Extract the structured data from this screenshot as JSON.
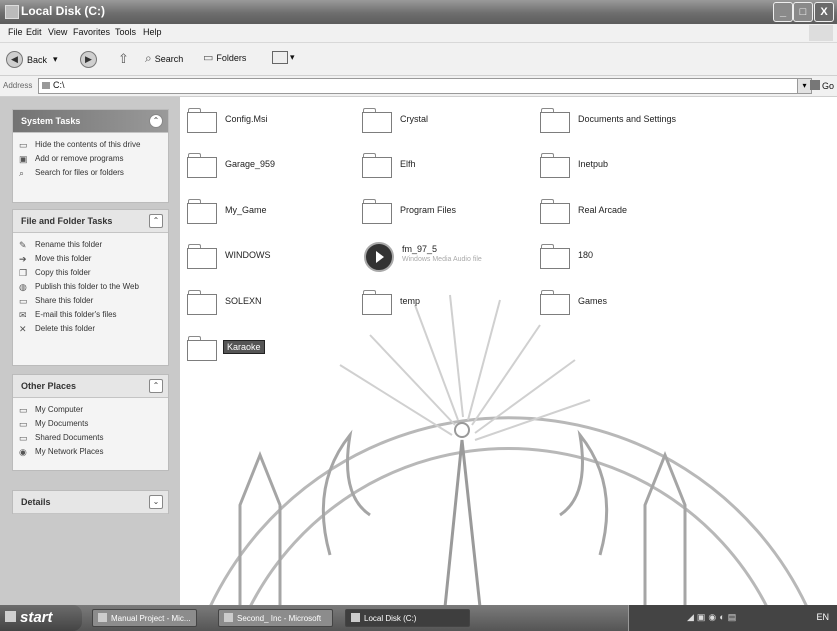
{
  "window": {
    "title": "Local Disk (C:)",
    "min": "_",
    "max": "□",
    "close": "X"
  },
  "menu": [
    "File",
    "Edit",
    "View",
    "Favorites",
    "Tools",
    "Help"
  ],
  "toolbar": {
    "back": "Back",
    "search": "Search",
    "folders": "Folders"
  },
  "address": {
    "label": "Address",
    "value": "C:\\",
    "go": "Go"
  },
  "system_tasks": {
    "title": "System Tasks",
    "items": [
      {
        "icon": "folder-icon",
        "label": "Hide the contents of this drive"
      },
      {
        "icon": "add-remove-icon",
        "label": "Add or remove programs"
      },
      {
        "icon": "search-icon",
        "label": "Search for files or folders"
      }
    ]
  },
  "file_tasks": {
    "title": "File and Folder Tasks",
    "items": [
      {
        "icon": "rename-icon",
        "label": "Rename this folder"
      },
      {
        "icon": "move-icon",
        "label": "Move this folder"
      },
      {
        "icon": "copy-icon",
        "label": "Copy this folder"
      },
      {
        "icon": "publish-icon",
        "label": "Publish this folder to the Web"
      },
      {
        "icon": "share-icon",
        "label": "Share this folder"
      },
      {
        "icon": "email-icon",
        "label": "E-mail this folder's files"
      },
      {
        "icon": "delete-icon",
        "label": "Delete this folder"
      }
    ]
  },
  "other_places": {
    "title": "Other Places",
    "items": [
      {
        "icon": "computer-icon",
        "label": "My Computer"
      },
      {
        "icon": "documents-icon",
        "label": "My Documents"
      },
      {
        "icon": "shared-icon",
        "label": "Shared Documents"
      },
      {
        "icon": "network-icon",
        "label": "My Network Places"
      }
    ]
  },
  "details": {
    "title": "Details"
  },
  "files": [
    {
      "name": "Config.Msi"
    },
    {
      "name": "Crystal"
    },
    {
      "name": "Documents and Settings"
    },
    {
      "name": "Garage_959"
    },
    {
      "name": "Elfh"
    },
    {
      "name": "Inetpub"
    },
    {
      "name": "My_Game"
    },
    {
      "name": "Program Files"
    },
    {
      "name": "Real Arcade"
    },
    {
      "name": "WINDOWS"
    },
    {
      "name": "fm_97_5",
      "sub": "Windows Media Audio file",
      "type": "media"
    },
    {
      "name": "180"
    },
    {
      "name": "SOLEXN"
    },
    {
      "name": "temp"
    },
    {
      "name": "Games"
    },
    {
      "name": "Karaoke",
      "selected": true
    }
  ],
  "taskbar": {
    "start": "start",
    "buttons": [
      "Manual Project - Mic...",
      "Second_ Inc - Microsoft",
      "Local Disk (C:)"
    ],
    "clock": "EN"
  }
}
